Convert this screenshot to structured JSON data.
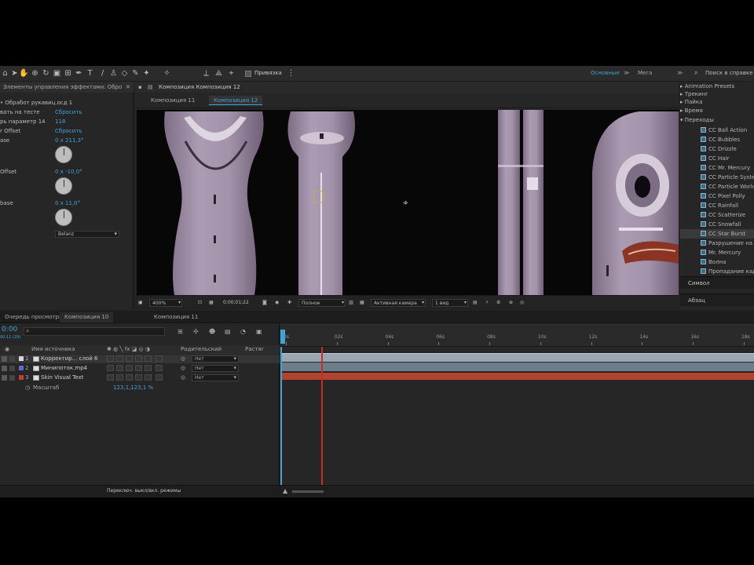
{
  "toolbar": {
    "snapping_label": "Привязка",
    "workspace_default": "Основные",
    "workspace_more": "Мега",
    "search_placeholder": "Поиск в справке"
  },
  "effects_panel": {
    "tab_title": "Элементы управления эффектами: Обро",
    "target_line": "• Обработ рукавиц.осд 1",
    "rows": [
      {
        "label": "вать на тесте",
        "value": "Сбросить"
      },
      {
        "label": "рь параметр 14",
        "value": "118"
      },
      {
        "label": "r Offset",
        "value": "Сбросить"
      },
      {
        "label": "ase",
        "value": "0 x 211,3°"
      },
      {
        "label": "Offset",
        "value": "0 x -10,0°"
      },
      {
        "label": "base",
        "value": "0 x 11,0°"
      }
    ],
    "mode_value": "Belanz"
  },
  "viewer": {
    "tab_title": "Композиция Композиция 12",
    "subtabs": [
      "Композиция 11",
      "Композиция 12"
    ],
    "status": {
      "zoom": "400%",
      "timecode": "0;00;01;22",
      "resolution": "Полное",
      "camera": "Активная камера",
      "views": "1 вид"
    }
  },
  "presets_panel": {
    "folders": [
      "Animation Presets",
      "Трекинг",
      "Пайка",
      "Время",
      "Переходы"
    ],
    "items": [
      "CC Ball Action",
      "CC Bubbles",
      "CC Drizzle",
      "CC Hair",
      "CC Mr. Mercury",
      "CC Particle Syste",
      "CC Particle World",
      "CC Pixel Polly",
      "CC Rainfall",
      "CC Scatterize",
      "CC Snowfall",
      "CC Star Burst",
      "Разрушение на",
      "Mr. Mercury",
      "Волна",
      "Пропадание кадр"
    ],
    "selected_index": 11,
    "bottom_tabs": [
      "Символ",
      "Абзац"
    ]
  },
  "timeline": {
    "tabs": [
      "Очередь просмотра",
      "Композиция 10",
      "Композиция 11"
    ],
    "current_time": "0:00",
    "fps_label": "00:11 (29)",
    "search_placeholder": "",
    "col_source_name": "Имя источника",
    "col_parent": "Родительский",
    "col_stretch": "Растяг",
    "layers": [
      {
        "num": "1",
        "name": "Корректир... слой 6",
        "parent": "Нет",
        "color": "#d7d7d7"
      },
      {
        "num": "2",
        "name": "Минипоток.mp4",
        "parent": "Нет",
        "color": "#5c6ccc"
      },
      {
        "num": "3",
        "name": "Skin Visual Text",
        "parent": "Нет",
        "color": "#c23d3d"
      }
    ],
    "sublayer": {
      "name": "Масштаб",
      "value": "123,1,123,1 %"
    },
    "ruler": [
      "0s",
      "02s",
      "04s",
      "06s",
      "08s",
      "10s",
      "12s",
      "14s",
      "16s",
      "18s"
    ],
    "bottom_toggle": "Переключ. выкл/вкл. режимы",
    "playhead_fraction": 0.086
  }
}
